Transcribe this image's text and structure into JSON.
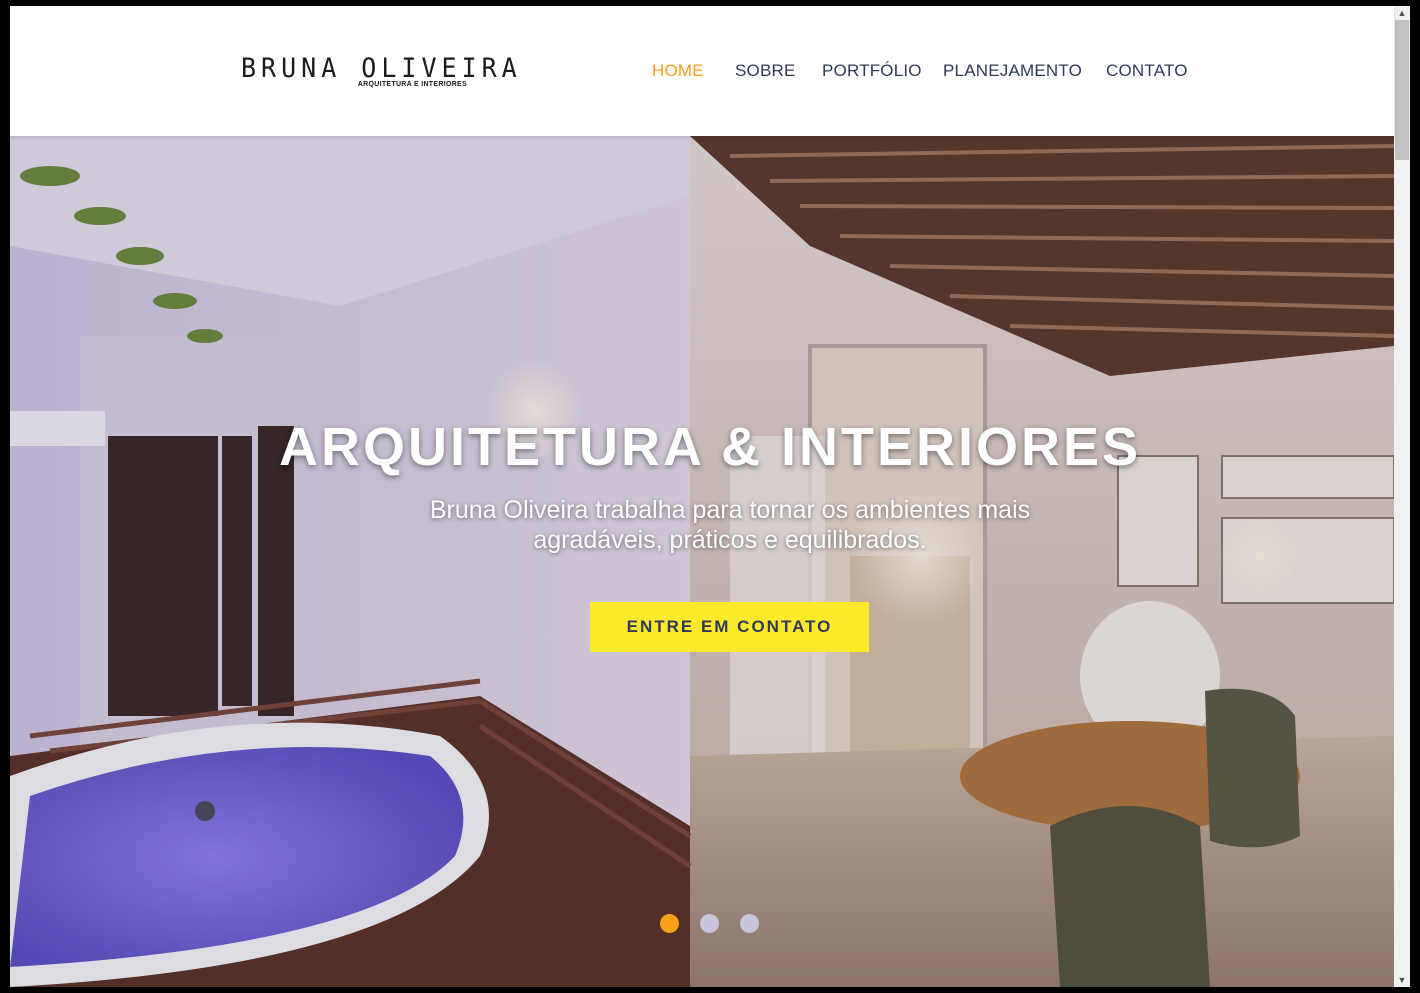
{
  "brand": {
    "name": "BRUNA OLIVEIRA",
    "tagline": "ARQUITETURA E INTERIORES"
  },
  "nav": {
    "items": [
      {
        "label": "HOME",
        "active": true
      },
      {
        "label": "SOBRE",
        "active": false
      },
      {
        "label": "PORTFÓLIO",
        "active": false
      },
      {
        "label": "PLANEJAMENTO",
        "active": false
      },
      {
        "label": "CONTATO",
        "active": false
      }
    ]
  },
  "hero": {
    "title": "ARQUITETURA & INTERIORES",
    "subtitle": "Bruna Oliveira trabalha para tornar os ambientes mais agradáveis, práticos e equilibrados.",
    "cta_label": "ENTRE EM CONTATO",
    "slides_count": 3,
    "active_slide": 1
  },
  "colors": {
    "accent": "#f0a01c",
    "nav_text": "#2f3a55",
    "cta_bg": "#fde92b",
    "dot_active": "#f6a11b",
    "dot_inactive": "#c8c6dc"
  }
}
